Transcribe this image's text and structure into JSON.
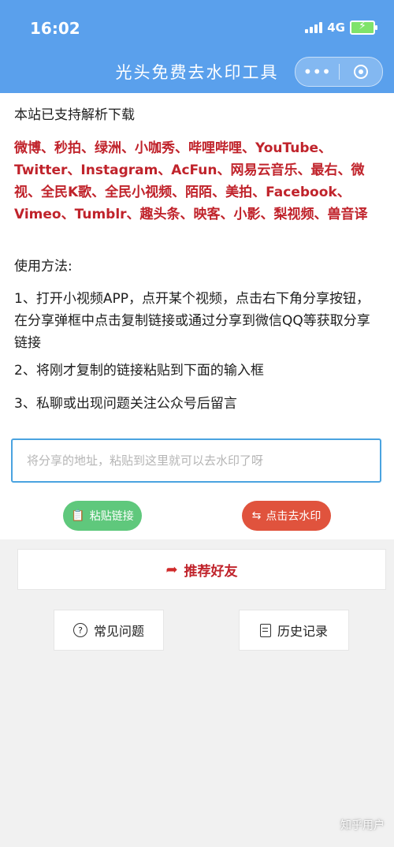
{
  "status_bar": {
    "time": "16:02",
    "network": "4G"
  },
  "nav": {
    "title": "光头免费去水印工具",
    "more_icon": "more-dots-icon",
    "close_icon": "target-close-icon"
  },
  "intro": {
    "heading": "本站已支持解析下载",
    "supported_platforms": "微博、秒拍、绿洲、小咖秀、哔哩哔哩、YouTube、Twitter、Instagram、AcFun、网易云音乐、最右、微视、全民K歌、全民小视频、陌陌、美拍、Facebook、Vimeo、Tumblr、趣头条、映客、小影、梨视频、兽音译"
  },
  "usage": {
    "heading": "使用方法:",
    "step1": "1、打开小视频APP，点开某个视频，点击右下角分享按钮，在分享弹框中点击复制链接或通过分享到微信QQ等获取分享链接",
    "step2": "2、将刚才复制的链接粘贴到下面的输入框",
    "step3": "3、私聊或出现问题关注公众号后留言"
  },
  "input": {
    "placeholder": "将分享的地址，粘贴到这里就可以去水印了呀",
    "value": ""
  },
  "buttons": {
    "paste_label": "粘贴链接",
    "remove_label": "点击去水印",
    "recommend_label": "推荐好友",
    "faq_label": "常见问题",
    "history_label": "历史记录"
  },
  "watermark": "知乎用户",
  "colors": {
    "nav_bg": "#5aa0ec",
    "accent_red": "#c0232b",
    "paste_green": "#5fc87c",
    "remove_red": "#e0533d",
    "input_border": "#4aa3e0"
  }
}
